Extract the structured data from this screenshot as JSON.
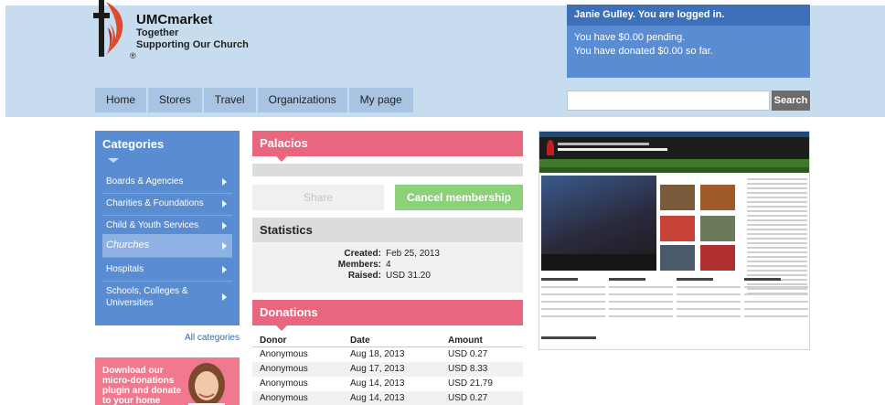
{
  "brand": {
    "name": "UMCmarket",
    "tagline_1": "Together",
    "tagline_2": "Supporting Our Church",
    "registered": "®"
  },
  "nav": {
    "tabs": [
      "Home",
      "Stores",
      "Travel",
      "Organizations",
      "My page"
    ]
  },
  "account": {
    "greeting": "Janie Gulley. You are logged in.",
    "pending": "You have $0.00 pending.",
    "donated": "You have donated $0.00 so far."
  },
  "search": {
    "button_label": "Search",
    "value": ""
  },
  "categories": {
    "title": "Categories",
    "items": [
      "Boards & Agencies",
      "Charities & Foundations",
      "Child & Youth Services",
      "Churches",
      "Hospitals",
      "Schools, Colleges & Universities"
    ],
    "active": "Churches",
    "all_link": "All categories"
  },
  "promo": {
    "text": "Download our micro-donations plugin and donate to your home"
  },
  "organization": {
    "name": "Palacios",
    "share_label": "Share",
    "cancel_label": "Cancel membership"
  },
  "statistics": {
    "title": "Statistics",
    "created_label": "Created:",
    "created_value": "Feb 25, 2013",
    "members_label": "Members:",
    "members_value": "4",
    "raised_label": "Raised:",
    "raised_value": "USD 31.20"
  },
  "donations": {
    "title": "Donations",
    "columns": [
      "Donor",
      "Date",
      "Amount"
    ],
    "rows": [
      [
        "Anonymous",
        "Aug 18, 2013",
        "USD 0.27"
      ],
      [
        "Anonymous",
        "Aug 17, 2013",
        "USD 8.33"
      ],
      [
        "Anonymous",
        "Aug 14, 2013",
        "USD 21.79"
      ],
      [
        "Anonymous",
        "Aug 14, 2013",
        "USD 0.27"
      ]
    ]
  },
  "colors": {
    "header_bg": "#c8dcf0",
    "nav_tab": "#a9c4e3",
    "account_bg": "#5a8cd2",
    "category_bg": "#5a8cd2",
    "pink_accent": "#e8677f",
    "cancel_green": "#8cd17a"
  }
}
